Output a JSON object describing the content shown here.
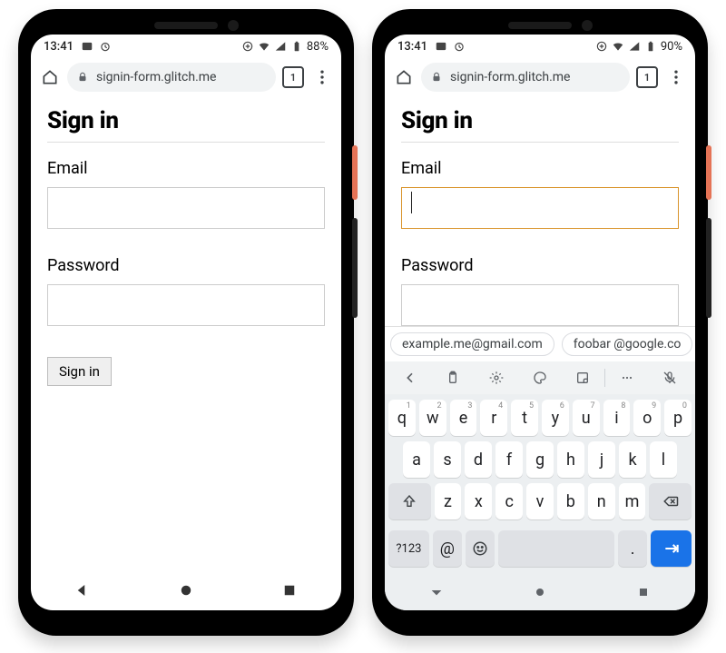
{
  "phones": {
    "left": {
      "status": {
        "time": "13:41",
        "battery_text": "88%"
      },
      "chrome": {
        "url": "signin-form.glitch.me",
        "tab_count": "1"
      },
      "page": {
        "heading": "Sign in",
        "email_label": "Email",
        "email_value": "",
        "password_label": "Password",
        "password_value": "",
        "submit_label": "Sign in"
      }
    },
    "right": {
      "status": {
        "time": "13:41",
        "battery_text": "90%"
      },
      "chrome": {
        "url": "signin-form.glitch.me",
        "tab_count": "1"
      },
      "page": {
        "heading": "Sign in",
        "email_label": "Email",
        "email_value": "",
        "password_label": "Password",
        "password_value": "",
        "submit_label": "Sign in"
      },
      "autofill": {
        "suggestion1": "example.me@gmail.com",
        "suggestion2": "foobar @google.co"
      },
      "keyboard": {
        "row1": [
          "q",
          "w",
          "e",
          "r",
          "t",
          "y",
          "u",
          "i",
          "o",
          "p"
        ],
        "row1_super": [
          "1",
          "2",
          "3",
          "4",
          "5",
          "6",
          "7",
          "8",
          "9",
          "0"
        ],
        "row2": [
          "a",
          "s",
          "d",
          "f",
          "g",
          "h",
          "j",
          "k",
          "l"
        ],
        "row3": [
          "z",
          "x",
          "c",
          "v",
          "b",
          "n",
          "m"
        ],
        "sym_key": "?123",
        "at_key": "@",
        "period_key": "."
      }
    }
  }
}
